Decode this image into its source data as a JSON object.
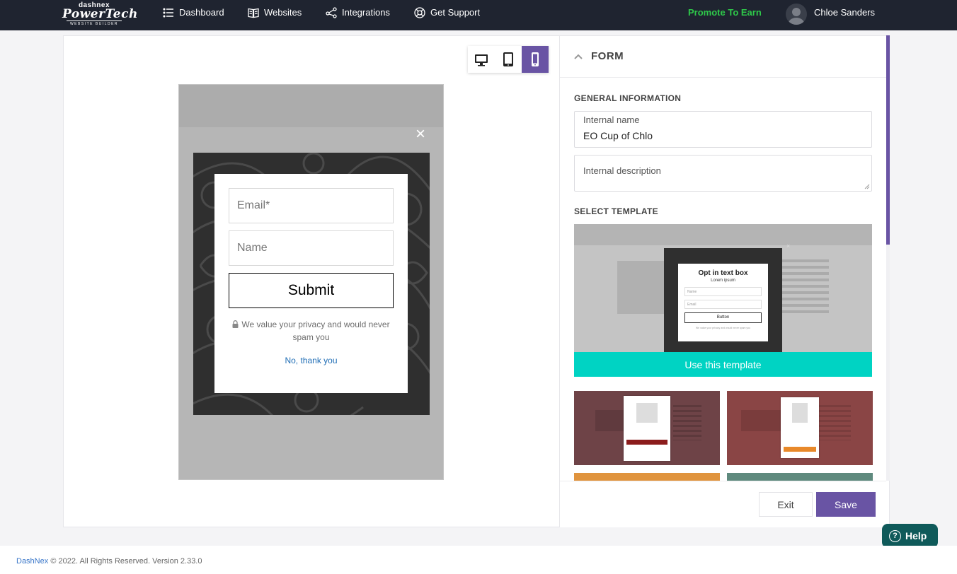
{
  "header": {
    "logo": {
      "top": "dashnex",
      "main": "PowerTech",
      "sub": "WEBSITE BUILDER"
    },
    "nav": [
      {
        "label": "Dashboard",
        "icon": "list-icon"
      },
      {
        "label": "Websites",
        "icon": "book-icon"
      },
      {
        "label": "Integrations",
        "icon": "share-icon"
      },
      {
        "label": "Get Support",
        "icon": "lifebuoy-icon"
      }
    ],
    "promote": "Promote To Earn",
    "username": "Chloe Sanders"
  },
  "device_toggle": {
    "active": "mobile",
    "options": [
      "desktop",
      "tablet",
      "mobile"
    ]
  },
  "preview": {
    "close": "×",
    "email_placeholder": "Email*",
    "name_placeholder": "Name",
    "submit": "Submit",
    "privacy": "We value your privacy and would never spam you",
    "decline": "No, thank you"
  },
  "form": {
    "section_header": "FORM",
    "general_info_title": "GENERAL INFORMATION",
    "internal_name_label": "Internal name",
    "internal_name_value": "EO Cup of Chlo",
    "internal_description_label": "Internal description",
    "select_template_title": "SELECT TEMPLATE",
    "template_preview": {
      "title": "Opt in text box",
      "subtitle": "Lorem ipsum",
      "name_placeholder": "Name",
      "email_placeholder": "Email",
      "button": "Button",
      "privacy": "We value your privacy and would never spam you"
    },
    "use_template": "Use this template",
    "exit": "Exit",
    "save": "Save"
  },
  "colors": {
    "accent": "#6954a4",
    "teal": "#00d3c3",
    "promote": "#2ec94a",
    "nav_bg": "#1f2430"
  },
  "help": {
    "label": "Help"
  },
  "footer": {
    "brand": "DashNex",
    "text": "© 2022. All Rights Reserved. Version 2.33.0"
  }
}
